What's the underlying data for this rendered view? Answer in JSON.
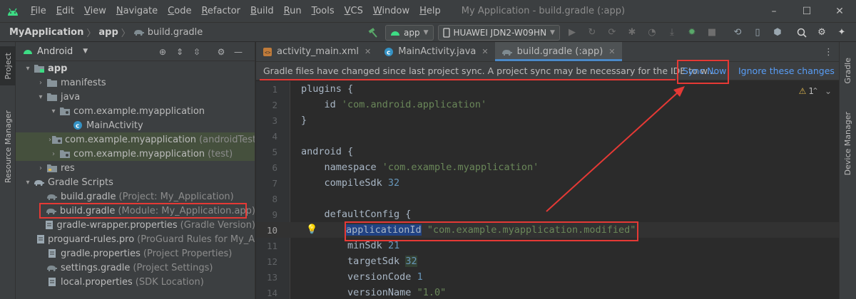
{
  "menubar": {
    "items": [
      "File",
      "Edit",
      "View",
      "Navigate",
      "Code",
      "Refactor",
      "Build",
      "Run",
      "Tools",
      "VCS",
      "Window",
      "Help"
    ],
    "window_title": "My Application - build.gradle (:app)",
    "controls": {
      "minimize": "–",
      "maximize": "☐",
      "close": "✕"
    }
  },
  "navbar": {
    "project": "MyApplication",
    "module": "app",
    "file": "build.gradle",
    "run_config": "app",
    "device": "HUAWEI JDN2-W09HN"
  },
  "project_panel": {
    "view_mode": "Android",
    "tree": [
      {
        "label": "app",
        "dim": "",
        "level": 0,
        "arrow": "▾",
        "icon": "module-folder",
        "bold": true
      },
      {
        "label": "manifests",
        "dim": "",
        "level": 1,
        "arrow": "›",
        "icon": "folder"
      },
      {
        "label": "java",
        "dim": "",
        "level": 1,
        "arrow": "▾",
        "icon": "folder"
      },
      {
        "label": "com.example.myapplication",
        "dim": "",
        "level": 2,
        "arrow": "▾",
        "icon": "package"
      },
      {
        "label": "MainActivity",
        "dim": "",
        "level": 3,
        "arrow": "",
        "icon": "class"
      },
      {
        "label": "com.example.myapplication",
        "dim": "(androidTest)",
        "level": 2,
        "arrow": "›",
        "icon": "package",
        "highlight": true
      },
      {
        "label": "com.example.myapplication",
        "dim": "(test)",
        "level": 2,
        "arrow": "›",
        "icon": "package",
        "highlight": true
      },
      {
        "label": "res",
        "dim": "",
        "level": 1,
        "arrow": "›",
        "icon": "res-folder"
      },
      {
        "label": "Gradle Scripts",
        "dim": "",
        "level": 0,
        "arrow": "▾",
        "icon": "gradle"
      },
      {
        "label": "build.gradle",
        "dim": "(Project: My_Application)",
        "level": 1,
        "arrow": "",
        "icon": "gradle-elephant"
      },
      {
        "label": "build.gradle",
        "dim": "(Module: My_Application.app)",
        "level": 1,
        "arrow": "",
        "icon": "gradle-elephant",
        "selected": true
      },
      {
        "label": "gradle-wrapper.properties",
        "dim": "(Gradle Version)",
        "level": 1,
        "arrow": "",
        "icon": "properties"
      },
      {
        "label": "proguard-rules.pro",
        "dim": "(ProGuard Rules for My_Ap",
        "level": 1,
        "arrow": "",
        "icon": "properties"
      },
      {
        "label": "gradle.properties",
        "dim": "(Project Properties)",
        "level": 1,
        "arrow": "",
        "icon": "properties"
      },
      {
        "label": "settings.gradle",
        "dim": "(Project Settings)",
        "level": 1,
        "arrow": "",
        "icon": "gradle-elephant"
      },
      {
        "label": "local.properties",
        "dim": "(SDK Location)",
        "level": 1,
        "arrow": "",
        "icon": "properties"
      }
    ]
  },
  "side_tabs": {
    "left": [
      "Project",
      "Resource Manager"
    ],
    "right": [
      "Gradle",
      "Device Manager"
    ]
  },
  "editor": {
    "tabs": [
      {
        "label": "activity_main.xml",
        "icon": "xml"
      },
      {
        "label": "MainActivity.java",
        "icon": "class"
      },
      {
        "label": "build.gradle (:app)",
        "icon": "gradle-elephant",
        "active": true
      }
    ],
    "notification": {
      "message": "Gradle files have changed since last project sync. A project sync may be necessary for the IDE to w...",
      "sync_now": "Sync Now",
      "ignore": "Ignore these changes"
    },
    "warning_count": "1",
    "lines": [
      {
        "n": "1",
        "text": "plugins {"
      },
      {
        "n": "2",
        "text": "    id 'com.android.application'"
      },
      {
        "n": "3",
        "text": "}"
      },
      {
        "n": "4",
        "text": ""
      },
      {
        "n": "5",
        "text": "android {"
      },
      {
        "n": "6",
        "text": "    namespace 'com.example.myapplication'"
      },
      {
        "n": "7",
        "text": "    compileSdk 32"
      },
      {
        "n": "8",
        "text": ""
      },
      {
        "n": "9",
        "text": "    defaultConfig {"
      },
      {
        "n": "10",
        "text": "        applicationId \"com.example.myapplication.modified\""
      },
      {
        "n": "11",
        "text": "        minSdk 21"
      },
      {
        "n": "12",
        "text": "        targetSdk 32"
      },
      {
        "n": "13",
        "text": "        versionCode 1"
      },
      {
        "n": "14",
        "text": "        versionName \"1.0\""
      }
    ]
  },
  "colors": {
    "accent_blue": "#4a88c7",
    "annotation_red": "#e53935",
    "string_green": "#6a8759",
    "number_blue": "#6897bb"
  }
}
